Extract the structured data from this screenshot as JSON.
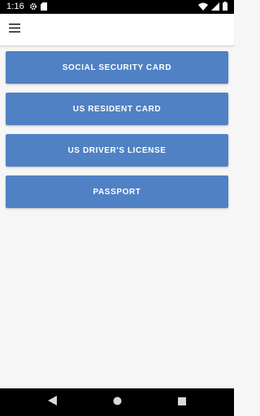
{
  "status_bar": {
    "time": "1:16",
    "left_icons": [
      "gear-icon",
      "sim-card-icon"
    ],
    "right_icons": [
      "wifi-icon",
      "signal-icon",
      "battery-icon"
    ]
  },
  "app_bar": {
    "menu_icon": "hamburger-menu-icon"
  },
  "buttons": [
    {
      "label": "SOCIAL SECURITY CARD"
    },
    {
      "label": "US RESIDENT CARD"
    },
    {
      "label": "US DRIVER'S LICENSE"
    },
    {
      "label": "PASSPORT"
    }
  ],
  "nav_bar": {
    "items": [
      "back-icon",
      "home-icon",
      "recents-icon"
    ]
  },
  "colors": {
    "button_background": "#4f81c4",
    "button_text": "#ffffff",
    "page_background": "#f6f6f6",
    "app_bar_background": "#ffffff",
    "system_bars": "#000000"
  }
}
